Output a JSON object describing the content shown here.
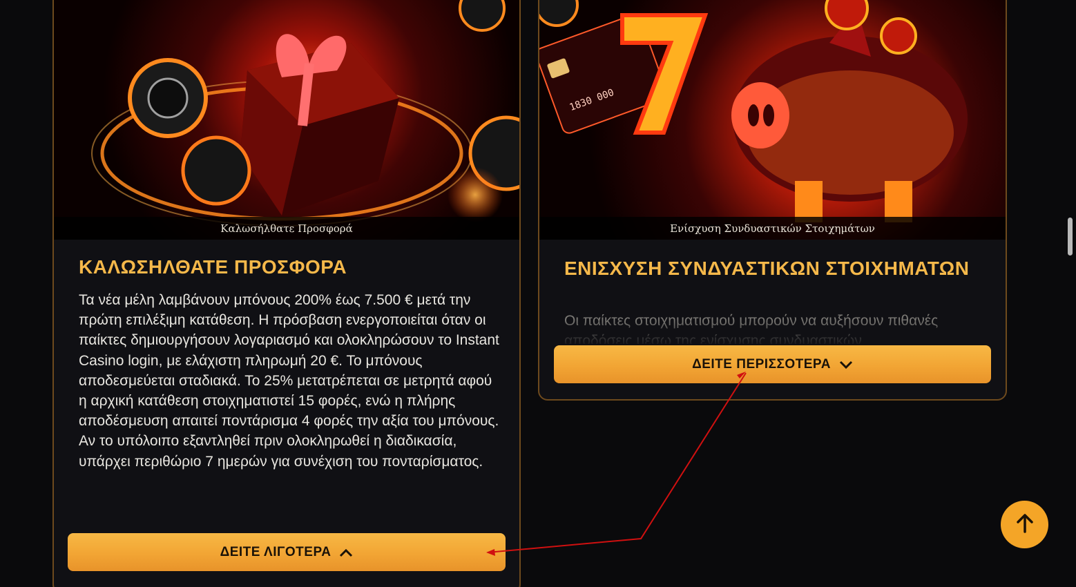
{
  "cards": [
    {
      "image_caption": "Καλωσήλθατε Προσφορά",
      "title": "ΚΑΛΩΣΗΛΘΑΤΕ ΠΡΟΣΦΟΡΑ",
      "text": "Τα νέα μέλη λαμβάνουν μπόνους 200% έως 7.500 € μετά την πρώτη επιλέξιμη κατάθεση. Η πρόσβαση ενεργοποιείται όταν οι παίκτες δημιουργήσουν λογαριασμό και ολοκληρώσουν το Instant Casino login, με ελάχιστη πληρωμή 20 €. Το μπόνους αποδεσμεύεται σταδιακά. Το 25% μετατρέπεται σε μετρητά αφού η αρχική κατάθεση στοιχηματιστεί 15 φορές, ενώ η πλήρης αποδέσμευση απαιτεί ποντάρισμα 4 φορές την αξία του μπόνους. Αν το υπόλοιπο εξαντληθεί πριν ολοκληρωθεί η διαδικασία, υπάρχει περιθώριο 7 ημερών για συνέχιση του πονταρίσματος.",
      "button_label": "ΔΕΙΤΕ ΛΙΓΟΤΕΡΑ",
      "button_icon": "chevron-up-icon",
      "card_1_card_text_6": "1830 000"
    },
    {
      "image_caption": "Ενίσχυση Συνδυαστικών Στοιχημάτων",
      "title": "ΕΝΙΣΧΥΣΗ ΣΥΝΔΥΑΣΤΙΚΩΝ ΣΤΟΙΧΗΜΑΤΩΝ",
      "text": "Οι παίκτες στοιχηματισμού μπορούν να αυξήσουν πιθανές αποδόσεις μέσω της ενίσχυσης συνδυαστικών",
      "button_label": "ΔΕΙΤΕ ΠΕΡΙΣΣΟΤΕΡΑ",
      "button_icon": "chevron-down-icon"
    }
  ],
  "scroll_top": {
    "icon": "arrow-up-icon"
  },
  "colors": {
    "accent": "#f4a527",
    "title": "#f5b84a",
    "card_border": "#6e4a1d",
    "annotation": "#d01010"
  }
}
